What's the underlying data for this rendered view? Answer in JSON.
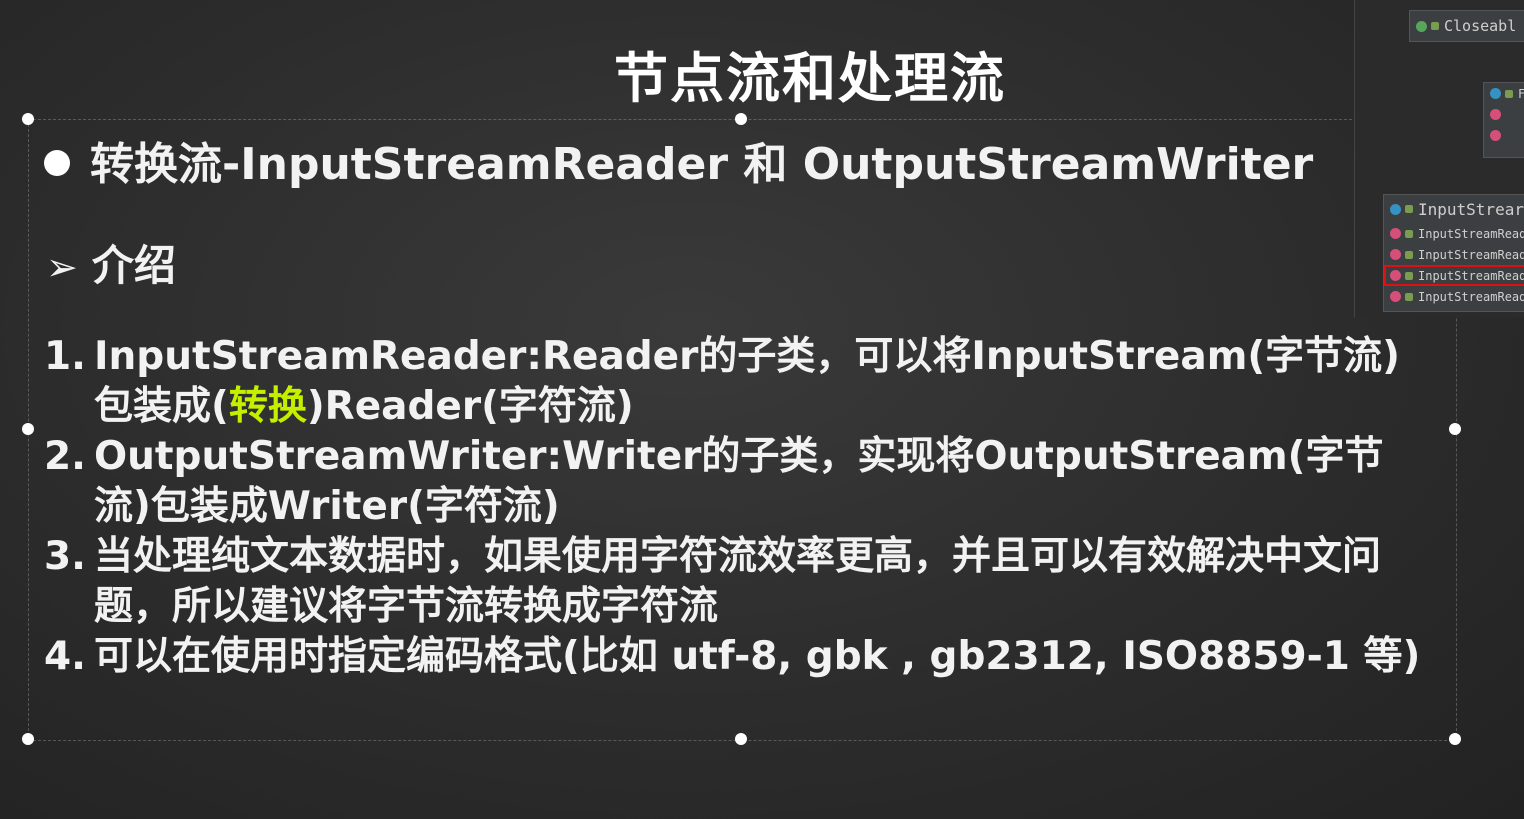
{
  "slide": {
    "title": "节点流和处理流",
    "bullet": "转换流-InputStreamReader 和 OutputStreamWriter",
    "subheading": "介绍",
    "items": [
      {
        "num": "1.",
        "text_before": "InputStreamReader:Reader的子类，可以将InputStream(字节流)包装成(",
        "highlight": "转换",
        "text_after": ")Reader(字符流)"
      },
      {
        "num": "2.",
        "text": "OutputStreamWriter:Writer的子类，实现将OutputStream(字节流)包装成Writer(字符流)"
      },
      {
        "num": "3.",
        "text": "当处理纯文本数据时，如果使用字符流效率更高，并且可以有效解决中文问题，所以建议将字节流转换成字符流"
      },
      {
        "num": "4.",
        "text": "可以在使用时指定编码格式(比如 utf-8, gbk , gb2312, ISO8859-1 等)"
      }
    ],
    "highlight_color": "#c4f000"
  },
  "ide_panel": {
    "closeable_label": "Closeabl",
    "middle_box_label": "F",
    "input_stream_label": "InputStrear",
    "constructors": [
      "InputStreamReade",
      "InputStreamReade",
      "InputStreamReade",
      "InputStreamReade"
    ],
    "selected_index": 2
  }
}
